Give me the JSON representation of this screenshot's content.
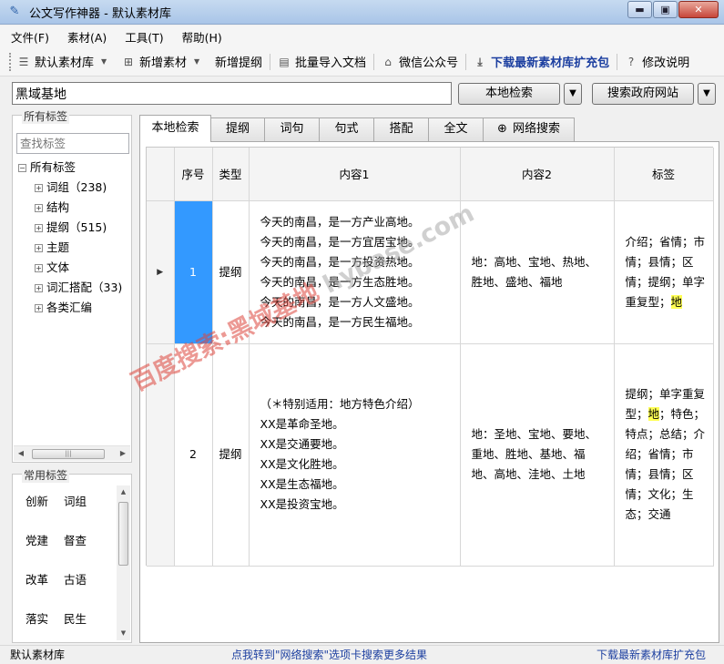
{
  "window": {
    "title": "公文写作神器 - 默认素材库",
    "min_label": "▬",
    "max_label": "▣",
    "close_label": "✕"
  },
  "menu": [
    "文件(F)",
    "素材(A)",
    "工具(T)",
    "帮助(H)"
  ],
  "toolbar": {
    "library": "默认素材库",
    "add_material": "新增素材",
    "add_outline": "新增提纲",
    "batch_import": "批量导入文档",
    "wechat": "微信公众号",
    "download": "下载最新素材库扩充包",
    "changelog": "修改说明"
  },
  "search": {
    "value": "黑域基地",
    "local_button": "本地检索",
    "gov_button": "搜索政府网站"
  },
  "tags_panel": {
    "title": "所有标签",
    "placeholder": "查找标签",
    "root": "所有标签",
    "items": [
      "词组（238)",
      "结构",
      "提纲（515)",
      "主题",
      "文体",
      "词汇搭配（33)",
      "各类汇编"
    ]
  },
  "common_tags": {
    "title": "常用标签",
    "items": [
      "创新",
      "词组",
      "党建",
      "督查",
      "改革",
      "古语",
      "落实",
      "民生"
    ]
  },
  "tabs": [
    "本地检索",
    "提纲",
    "词句",
    "句式",
    "搭配",
    "全文",
    "网络搜索"
  ],
  "table": {
    "headers": [
      "序号",
      "类型",
      "内容1",
      "内容2",
      "标签"
    ],
    "rows": [
      {
        "num": "1",
        "type": "提纲",
        "c1": [
          "今天的南昌，是一方产业高地。",
          "今天的南昌，是一方宜居宝地。",
          "今天的南昌，是一方投资热地。",
          "今天的南昌，是一方生态胜地。",
          "今天的南昌，是一方人文盛地。",
          "今天的南昌，是一方民生福地。"
        ],
        "c2": "地：高地、宝地、热地、胜地、盛地、福地",
        "tag_before": "介绍；省情；市情；县情；区情；提纲；单字重复型；",
        "tag_hl": "地",
        "tag_after": ""
      },
      {
        "num": "2",
        "type": "提纲",
        "c1": [
          "（＊特别适用：地方特色介绍）",
          "XX是革命圣地。",
          "XX是交通要地。",
          "XX是文化胜地。",
          "XX是生态福地。",
          "XX是投资宝地。"
        ],
        "c2": "地：圣地、宝地、要地、重地、胜地、基地、福地、高地、洼地、土地",
        "tag_before": "提纲；单字重复型；",
        "tag_hl": "地",
        "tag_after": "；特色；特点；总结；介绍；省情；市情；县情；区情；文化；生态；交通"
      }
    ]
  },
  "watermark": {
    "cn": "百度搜索:黑域基地",
    "en": "hybase.com"
  },
  "status": {
    "left": "默认素材库",
    "middle": "点我转到\"网络搜索\"选项卡搜索更多结果",
    "right": "下载最新素材库扩充包"
  }
}
